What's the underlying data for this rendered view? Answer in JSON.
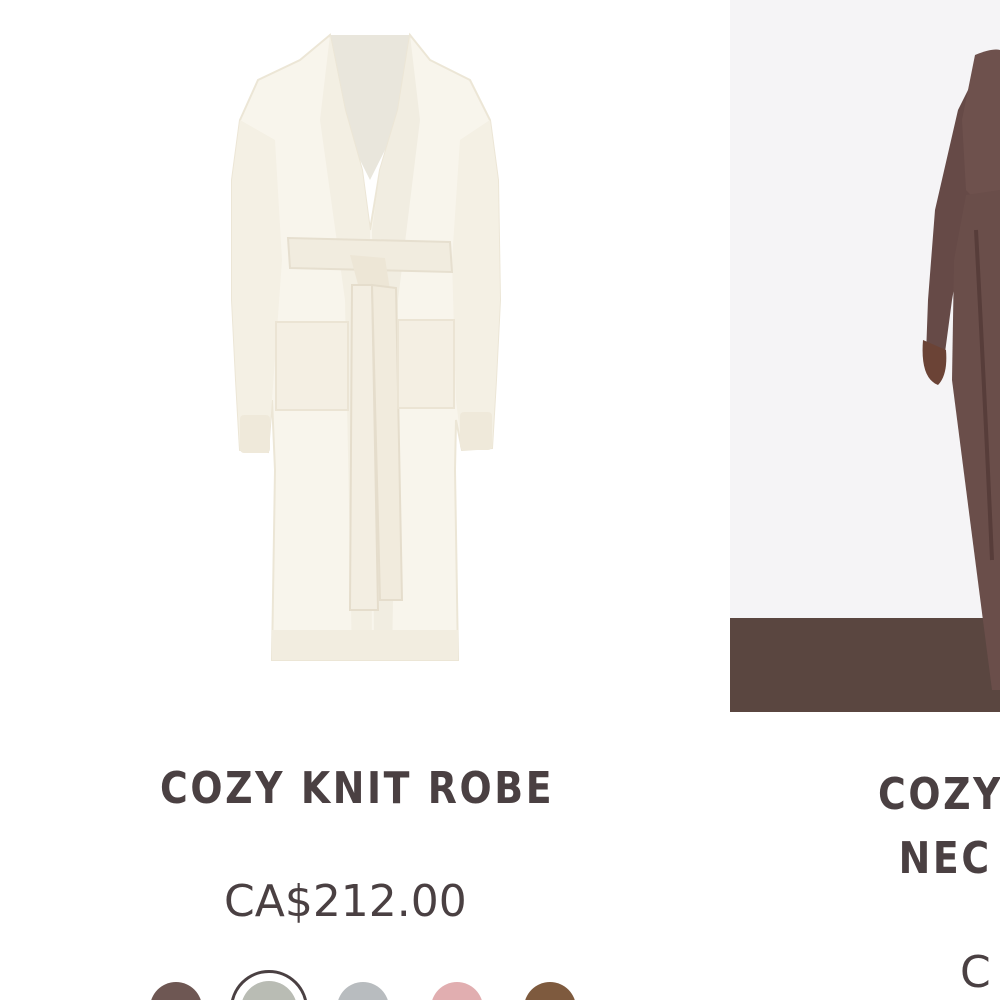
{
  "products": [
    {
      "title": "COZY KNIT ROBE",
      "price": "CA$212.00",
      "image_icon": "knit-robe-image",
      "swatches": [
        {
          "name": "cocoa",
          "color": "#6e5753",
          "selected": false
        },
        {
          "name": "stone",
          "color": "#b9bcb4",
          "selected": true
        },
        {
          "name": "light-gray",
          "color": "#b8bcbf",
          "selected": false
        },
        {
          "name": "rose",
          "color": "#e1aeb0",
          "selected": false
        },
        {
          "name": "camel",
          "color": "#7e5a3e",
          "selected": false
        }
      ]
    },
    {
      "title_line1": "COZY",
      "title_line2": "NEC",
      "price": "C",
      "image_icon": "model-lounge-set-image"
    }
  ],
  "colors": {
    "title": "#4a4042",
    "price": "#4a4042",
    "robe": "#f7f4ea",
    "robe_shadow": "#e7e1d2",
    "set_brown": "#6a4e4a",
    "floor_brown": "#5a4640"
  }
}
